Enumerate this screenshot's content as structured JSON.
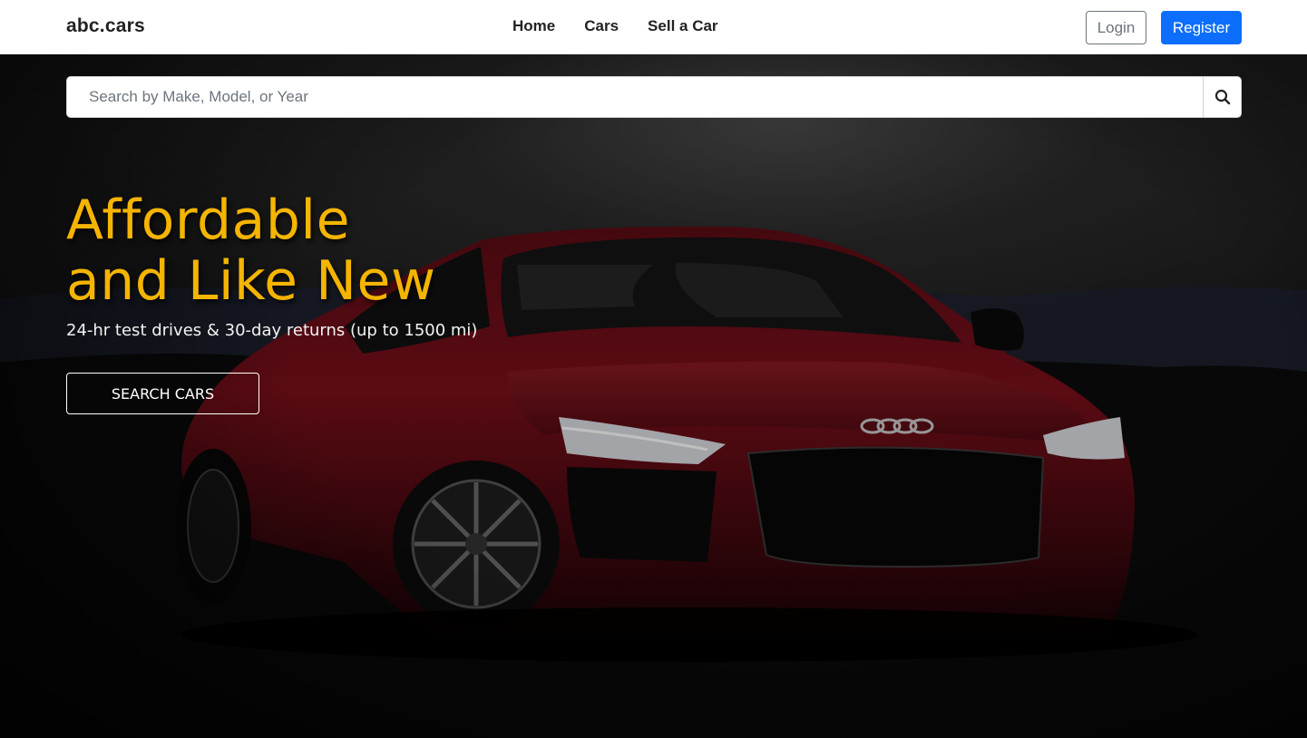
{
  "navbar": {
    "brand": "abc.cars",
    "links": [
      {
        "label": "Home"
      },
      {
        "label": "Cars"
      },
      {
        "label": "Sell a Car"
      }
    ],
    "login_label": "Login",
    "register_label": "Register"
  },
  "search": {
    "placeholder": "Search by Make, Model, or Year",
    "value": "",
    "icon": "search-icon"
  },
  "hero": {
    "title_line1": "Affordable",
    "title_line2": "and Like New",
    "subtitle": "24-hr test drives & 30-day returns (up to 1500 mi)",
    "cta_label": "SEARCH CARS",
    "image": "red-sports-car-background"
  },
  "colors": {
    "accent_yellow": "#f4b400",
    "primary_blue": "#0d6efd",
    "car_red": "#7a0f1a"
  }
}
